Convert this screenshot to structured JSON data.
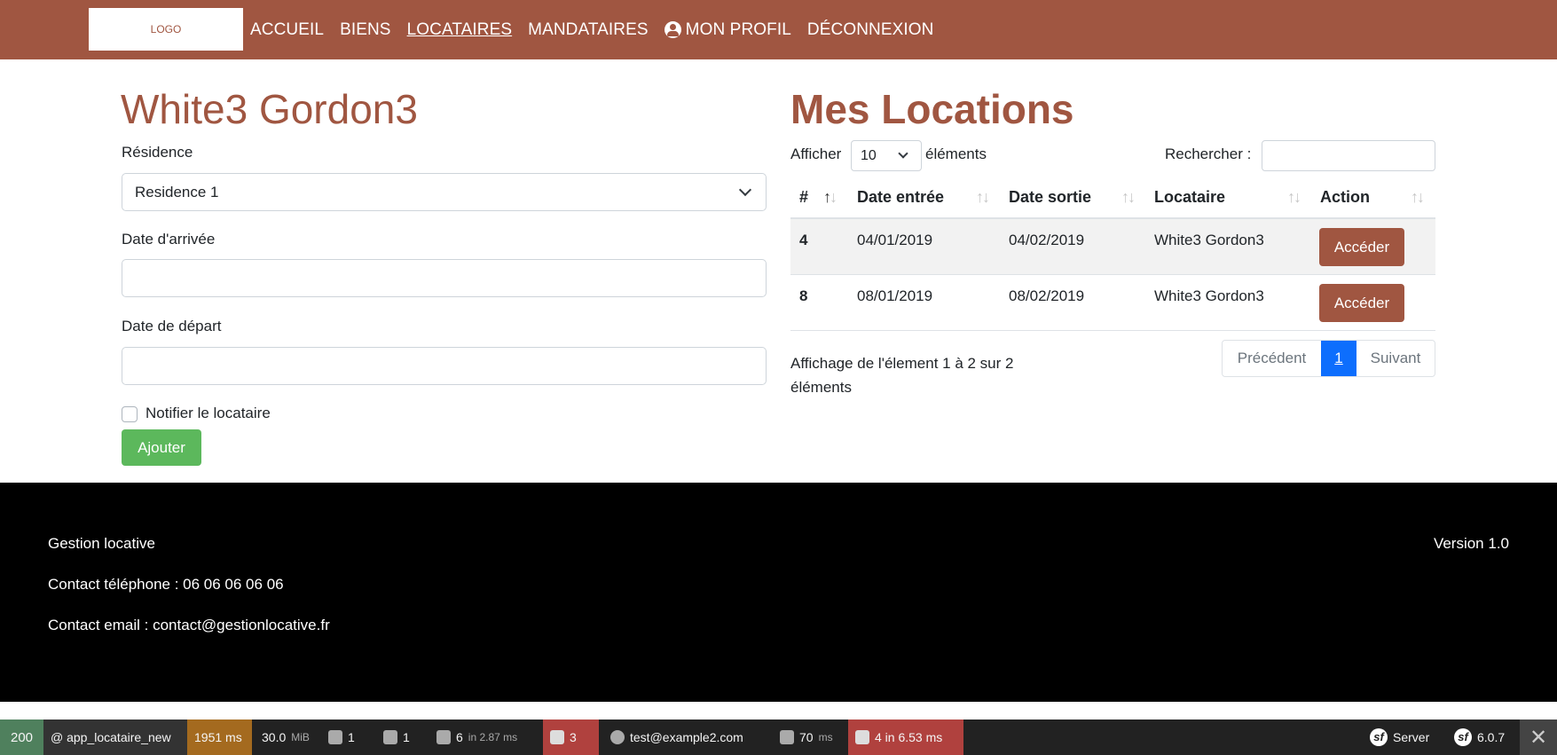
{
  "nav": {
    "logo": "LOGO",
    "links": [
      "ACCUEIL",
      "BIENS",
      "LOCATAIRES",
      "MANDATAIRES",
      "MON PROFIL",
      "DÉCONNEXION"
    ]
  },
  "form": {
    "title": "White3 Gordon3",
    "residence_label": "Résidence",
    "residence_value": "Residence 1",
    "arrival_label": "Date d'arrivée",
    "arrival_value": "",
    "departure_label": "Date de départ",
    "departure_value": "",
    "notify_label": "Notifier le locataire",
    "notify_checked": false,
    "submit_label": "Ajouter"
  },
  "locations": {
    "title": "Mes Locations",
    "show_label": "Afficher",
    "page_length": "10",
    "elements_label": "éléments",
    "search_label": "Rechercher :",
    "search_value": "",
    "columns": [
      "#",
      "Date entrée",
      "Date sortie",
      "Locataire",
      "Action"
    ],
    "rows": [
      {
        "id": "4",
        "date_in": "04/01/2019",
        "date_out": "04/02/2019",
        "tenant": "White3 Gordon3",
        "action": "Accéder"
      },
      {
        "id": "8",
        "date_in": "08/01/2019",
        "date_out": "08/02/2019",
        "tenant": "White3 Gordon3",
        "action": "Accéder"
      }
    ],
    "info": "Affichage de l'élement 1 à 2 sur 2 éléments",
    "pagination": {
      "prev": "Précédent",
      "current": "1",
      "next": "Suivant"
    }
  },
  "footer": {
    "company": "Gestion locative",
    "phone": "Contact téléphone : 06 06 06 06 06",
    "email": "Contact email : contact@gestionlocative.fr",
    "version": "Version 1.0"
  },
  "toolbar": {
    "status": "200",
    "route": "@ app_locataire_new",
    "time": "1951 ms",
    "memory_value": "30.0",
    "memory_unit": "MiB",
    "requests": "1",
    "logs": "1",
    "cache_value": "6",
    "cache_time": "in 2.87 ms",
    "translations": "3",
    "user": "test@example2.com",
    "twig_value": "70",
    "twig_unit": "ms",
    "db": "4 in 6.53 ms",
    "server": "Server",
    "version": "6.0.7",
    "colors": {
      "status": "#4f805d",
      "time": "#a46a1f",
      "alert": "#b0413e"
    }
  }
}
